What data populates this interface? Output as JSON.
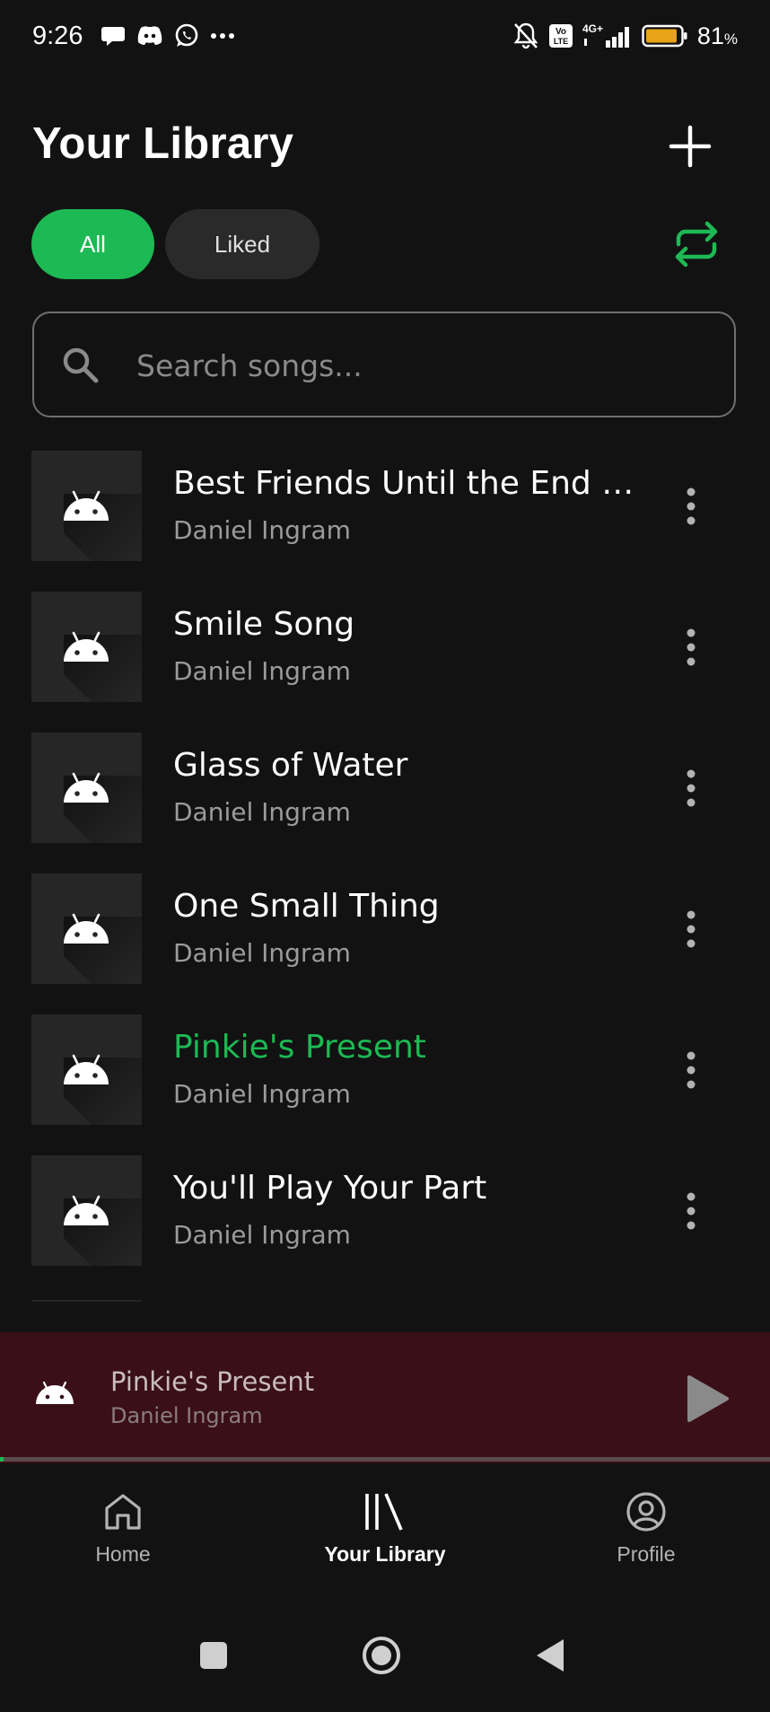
{
  "status_bar": {
    "time": "9:26",
    "left_icons": [
      "chat-bubble-icon",
      "discord-icon",
      "whatsapp-icon",
      "more-dots-icon"
    ],
    "right_icons": [
      "bell-off-icon",
      "volte-icon",
      "signal-4g-icon",
      "battery-icon"
    ],
    "network": "4G+",
    "volte": "Vo LTE",
    "battery_percent": "81",
    "battery_unit": "%",
    "battery_color": "#E8A317"
  },
  "header": {
    "title": "Your Library",
    "add_icon": "plus-icon"
  },
  "filters": {
    "chips": [
      "All",
      "Liked"
    ],
    "selected": "All",
    "repeat_icon": "repeat-icon"
  },
  "search": {
    "placeholder": "Search songs...",
    "value": ""
  },
  "songs": [
    {
      "title": "Best Friends Until the End of Time",
      "artist": "Daniel Ingram",
      "playing": false
    },
    {
      "title": "Smile Song",
      "artist": "Daniel Ingram",
      "playing": false
    },
    {
      "title": "Glass of Water",
      "artist": "Daniel Ingram",
      "playing": false
    },
    {
      "title": "One Small Thing",
      "artist": "Daniel Ingram",
      "playing": false
    },
    {
      "title": "Pinkie's Present",
      "artist": "Daniel Ingram",
      "playing": true
    },
    {
      "title": "You'll Play Your Part",
      "artist": "Daniel Ingram",
      "playing": false
    }
  ],
  "now_playing": {
    "title": "Pinkie's Present",
    "artist": "Daniel Ingram",
    "progress": 0.005,
    "background_color": "#3A0F17"
  },
  "bottom_nav": {
    "items": [
      {
        "label": "Home",
        "icon": "home-icon"
      },
      {
        "label": "Your Library",
        "icon": "library-icon"
      },
      {
        "label": "Profile",
        "icon": "profile-icon"
      }
    ],
    "active": "Your Library"
  },
  "system_nav": [
    "recents-icon",
    "home-circle-icon",
    "back-icon"
  ],
  "colors": {
    "accent": "#1DB954",
    "background": "#121212",
    "muted_text": "#9B9B9B"
  }
}
